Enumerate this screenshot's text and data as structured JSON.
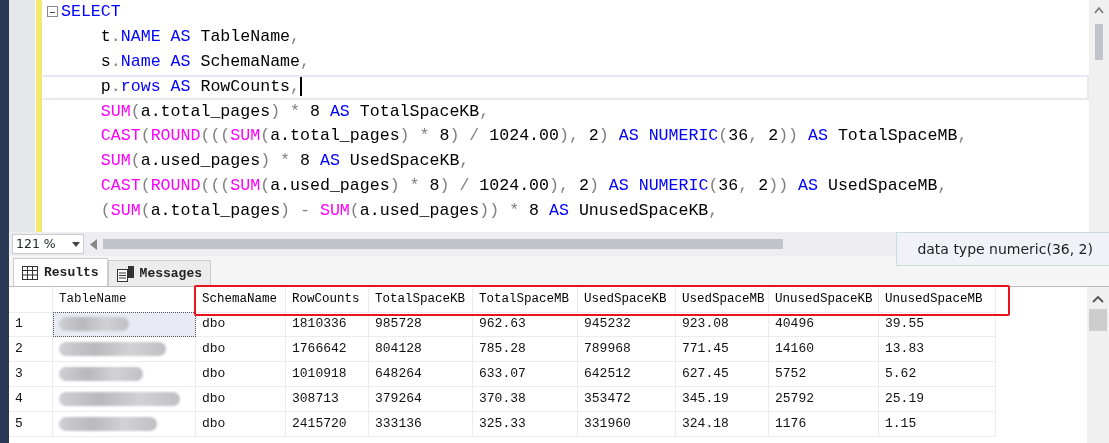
{
  "editor": {
    "lines": [
      {
        "current": false,
        "indented": false,
        "collapsible": true,
        "tokens": [
          {
            "kind": "keyword",
            "text": "SELECT"
          }
        ]
      },
      {
        "current": false,
        "indented": true,
        "tokens": [
          {
            "kind": "plain",
            "text": "t"
          },
          {
            "kind": "operator",
            "text": "."
          },
          {
            "kind": "keyword",
            "text": "NAME"
          },
          {
            "kind": "keyword",
            "text": "AS",
            "space": true
          },
          {
            "kind": "plain",
            "text": "TableName",
            "space": true
          },
          {
            "kind": "operator",
            "text": ","
          }
        ]
      },
      {
        "current": false,
        "indented": true,
        "tokens": [
          {
            "kind": "plain",
            "text": "s"
          },
          {
            "kind": "operator",
            "text": "."
          },
          {
            "kind": "keyword",
            "text": "Name"
          },
          {
            "kind": "keyword",
            "text": "AS",
            "space": true
          },
          {
            "kind": "plain",
            "text": "SchemaName",
            "space": true
          },
          {
            "kind": "operator",
            "text": ","
          }
        ]
      },
      {
        "current": true,
        "indented": true,
        "tokens": [
          {
            "kind": "plain",
            "text": "p"
          },
          {
            "kind": "operator",
            "text": "."
          },
          {
            "kind": "keyword",
            "text": "rows"
          },
          {
            "kind": "keyword",
            "text": "AS",
            "space": true
          },
          {
            "kind": "plain",
            "text": "RowCounts",
            "space": true
          },
          {
            "kind": "operator",
            "text": ","
          }
        ]
      },
      {
        "current": false,
        "indented": true,
        "tokens": [
          {
            "kind": "function",
            "text": "SUM"
          },
          {
            "kind": "operator",
            "text": "("
          },
          {
            "kind": "plain",
            "text": "a.total_pages"
          },
          {
            "kind": "operator",
            "text": ")"
          },
          {
            "kind": "operator",
            "text": "*",
            "space": true
          },
          {
            "kind": "plain",
            "text": "8",
            "space": true
          },
          {
            "kind": "keyword",
            "text": "AS",
            "space": true
          },
          {
            "kind": "plain",
            "text": "TotalSpaceKB",
            "space": true
          },
          {
            "kind": "operator",
            "text": ","
          }
        ]
      },
      {
        "current": false,
        "indented": true,
        "tokens": [
          {
            "kind": "function",
            "text": "CAST"
          },
          {
            "kind": "operator",
            "text": "("
          },
          {
            "kind": "function",
            "text": "ROUND"
          },
          {
            "kind": "operator",
            "text": "((("
          },
          {
            "kind": "function",
            "text": "SUM"
          },
          {
            "kind": "operator",
            "text": "("
          },
          {
            "kind": "plain",
            "text": "a.total_pages"
          },
          {
            "kind": "operator",
            "text": ")"
          },
          {
            "kind": "operator",
            "text": "*",
            "space": true
          },
          {
            "kind": "plain",
            "text": "8",
            "space": true
          },
          {
            "kind": "operator",
            "text": ")"
          },
          {
            "kind": "operator",
            "text": "/",
            "space": true
          },
          {
            "kind": "plain",
            "text": "1024.00",
            "space": true
          },
          {
            "kind": "operator",
            "text": "),"
          },
          {
            "kind": "plain",
            "text": "2",
            "space": true
          },
          {
            "kind": "operator",
            "text": ")"
          },
          {
            "kind": "keyword",
            "text": "AS",
            "space": true
          },
          {
            "kind": "keyword",
            "text": "NUMERIC",
            "space": true
          },
          {
            "kind": "operator",
            "text": "("
          },
          {
            "kind": "plain",
            "text": "36"
          },
          {
            "kind": "operator",
            "text": ","
          },
          {
            "kind": "plain",
            "text": "2",
            "space": true
          },
          {
            "kind": "operator",
            "text": "))"
          },
          {
            "kind": "keyword",
            "text": "AS",
            "space": true
          },
          {
            "kind": "plain",
            "text": "TotalSpaceMB",
            "space": true
          },
          {
            "kind": "operator",
            "text": ","
          }
        ]
      },
      {
        "current": false,
        "indented": true,
        "tokens": [
          {
            "kind": "function",
            "text": "SUM"
          },
          {
            "kind": "operator",
            "text": "("
          },
          {
            "kind": "plain",
            "text": "a.used_pages"
          },
          {
            "kind": "operator",
            "text": ")"
          },
          {
            "kind": "operator",
            "text": "*",
            "space": true
          },
          {
            "kind": "plain",
            "text": "8",
            "space": true
          },
          {
            "kind": "keyword",
            "text": "AS",
            "space": true
          },
          {
            "kind": "plain",
            "text": "UsedSpaceKB",
            "space": true
          },
          {
            "kind": "operator",
            "text": ","
          }
        ]
      },
      {
        "current": false,
        "indented": true,
        "tokens": [
          {
            "kind": "function",
            "text": "CAST"
          },
          {
            "kind": "operator",
            "text": "("
          },
          {
            "kind": "function",
            "text": "ROUND"
          },
          {
            "kind": "operator",
            "text": "((("
          },
          {
            "kind": "function",
            "text": "SUM"
          },
          {
            "kind": "operator",
            "text": "("
          },
          {
            "kind": "plain",
            "text": "a.used_pages"
          },
          {
            "kind": "operator",
            "text": ")"
          },
          {
            "kind": "operator",
            "text": "*",
            "space": true
          },
          {
            "kind": "plain",
            "text": "8",
            "space": true
          },
          {
            "kind": "operator",
            "text": ")"
          },
          {
            "kind": "operator",
            "text": "/",
            "space": true
          },
          {
            "kind": "plain",
            "text": "1024.00",
            "space": true
          },
          {
            "kind": "operator",
            "text": "),"
          },
          {
            "kind": "plain",
            "text": "2",
            "space": true
          },
          {
            "kind": "operator",
            "text": ")"
          },
          {
            "kind": "keyword",
            "text": "AS",
            "space": true
          },
          {
            "kind": "keyword",
            "text": "NUMERIC",
            "space": true
          },
          {
            "kind": "operator",
            "text": "("
          },
          {
            "kind": "plain",
            "text": "36"
          },
          {
            "kind": "operator",
            "text": ","
          },
          {
            "kind": "plain",
            "text": "2",
            "space": true
          },
          {
            "kind": "operator",
            "text": "))"
          },
          {
            "kind": "keyword",
            "text": "AS",
            "space": true
          },
          {
            "kind": "plain",
            "text": "UsedSpaceMB",
            "space": true
          },
          {
            "kind": "operator",
            "text": ","
          }
        ]
      },
      {
        "current": false,
        "indented": true,
        "tokens": [
          {
            "kind": "operator",
            "text": "("
          },
          {
            "kind": "function",
            "text": "SUM"
          },
          {
            "kind": "operator",
            "text": "("
          },
          {
            "kind": "plain",
            "text": "a.total_pages"
          },
          {
            "kind": "operator",
            "text": ")"
          },
          {
            "kind": "operator",
            "text": "-",
            "space": true
          },
          {
            "kind": "function",
            "text": "SUM",
            "space": true
          },
          {
            "kind": "operator",
            "text": "("
          },
          {
            "kind": "plain",
            "text": "a.used_pages"
          },
          {
            "kind": "operator",
            "text": "))"
          },
          {
            "kind": "operator",
            "text": "*",
            "space": true
          },
          {
            "kind": "plain",
            "text": "8",
            "space": true
          },
          {
            "kind": "keyword",
            "text": "AS",
            "space": true
          },
          {
            "kind": "plain",
            "text": "UnusedSpaceKB",
            "space": true
          },
          {
            "kind": "operator",
            "text": ","
          }
        ]
      }
    ]
  },
  "zoom": "121 %",
  "tooltip": "data type numeric(36, 2)",
  "tabs": [
    {
      "label": "Results",
      "selected": true,
      "kind": "grid"
    },
    {
      "label": "Messages",
      "selected": false,
      "kind": "messages"
    }
  ],
  "grid": {
    "columns": [
      {
        "label": "TableName",
        "highlighted": false
      },
      {
        "label": "SchemaName",
        "highlighted": true
      },
      {
        "label": "RowCounts",
        "highlighted": true
      },
      {
        "label": "TotalSpaceKB",
        "highlighted": true
      },
      {
        "label": "TotalSpaceMB",
        "highlighted": true
      },
      {
        "label": "UsedSpaceKB",
        "highlighted": true
      },
      {
        "label": "UsedSpaceMB",
        "highlighted": true
      },
      {
        "label": "UnusedSpaceKB",
        "highlighted": true
      },
      {
        "label": "UnusedSpaceMB",
        "highlighted": true
      }
    ],
    "rows": [
      {
        "number": "1",
        "name_selected": true,
        "values": [
          "dbo",
          "1810336",
          "985728",
          "962.63",
          "945232",
          "923.08",
          "40496",
          "39.55"
        ]
      },
      {
        "number": "2",
        "name_selected": false,
        "values": [
          "dbo",
          "1766642",
          "804128",
          "785.28",
          "789968",
          "771.45",
          "14160",
          "13.83"
        ]
      },
      {
        "number": "3",
        "name_selected": false,
        "values": [
          "dbo",
          "1010918",
          "648264",
          "633.07",
          "642512",
          "627.45",
          "5752",
          "5.62"
        ]
      },
      {
        "number": "4",
        "name_selected": false,
        "values": [
          "dbo",
          "308713",
          "379264",
          "370.38",
          "353472",
          "345.19",
          "25792",
          "25.19"
        ]
      },
      {
        "number": "5",
        "name_selected": false,
        "values": [
          "dbo",
          "2415720",
          "333136",
          "325.33",
          "331960",
          "324.18",
          "1176",
          "1.15"
        ]
      }
    ]
  }
}
